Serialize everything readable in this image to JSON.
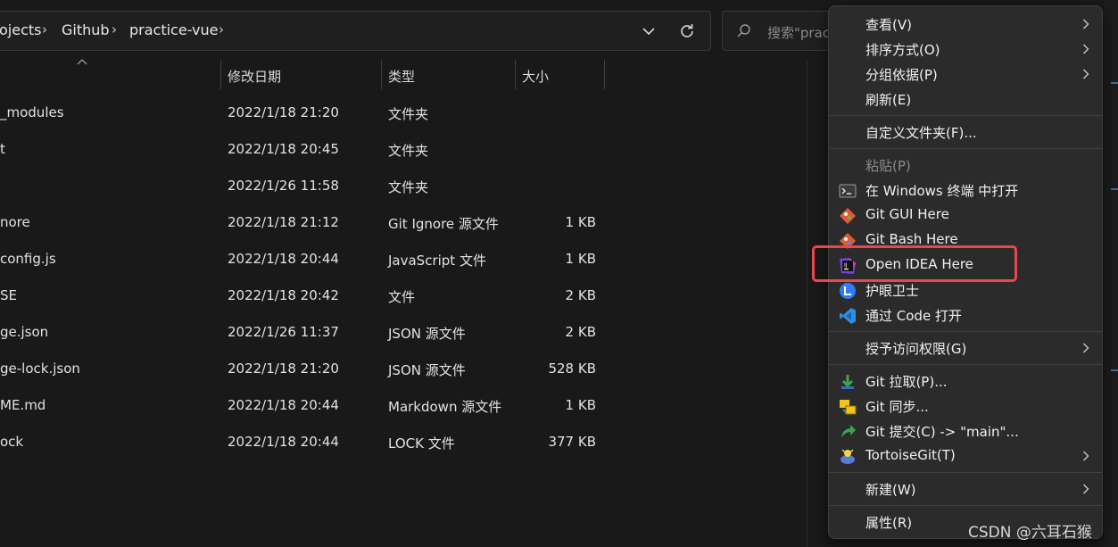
{
  "breadcrumb": {
    "items": [
      "ojects",
      "Github",
      "practice-vue"
    ],
    "separator": "›"
  },
  "search": {
    "placeholder": "搜索\"prac"
  },
  "columns": {
    "date": "修改日期",
    "type": "类型",
    "size": "大小"
  },
  "files": [
    {
      "name": "_modules",
      "date": "2022/1/18 21:20",
      "type": "文件夹",
      "size": ""
    },
    {
      "name": "t",
      "date": "2022/1/18 20:45",
      "type": "文件夹",
      "size": ""
    },
    {
      "name": "",
      "date": "2022/1/26 11:58",
      "type": "文件夹",
      "size": ""
    },
    {
      "name": "nore",
      "date": "2022/1/18 21:12",
      "type": "Git Ignore 源文件",
      "size": "1 KB"
    },
    {
      "name": "config.js",
      "date": "2022/1/18 20:44",
      "type": "JavaScript 文件",
      "size": "1 KB"
    },
    {
      "name": "SE",
      "date": "2022/1/18 20:42",
      "type": "文件",
      "size": "2 KB"
    },
    {
      "name": "ge.json",
      "date": "2022/1/26 11:37",
      "type": "JSON 源文件",
      "size": "2 KB"
    },
    {
      "name": "ge-lock.json",
      "date": "2022/1/18 21:20",
      "type": "JSON 源文件",
      "size": "528 KB"
    },
    {
      "name": "ME.md",
      "date": "2022/1/18 20:44",
      "type": "Markdown 源文件",
      "size": "1 KB"
    },
    {
      "name": "ock",
      "date": "2022/1/18 20:44",
      "type": "LOCK 文件",
      "size": "377 KB"
    }
  ],
  "menu": {
    "view": "查看(V)",
    "sort": "排序方式(O)",
    "group": "分组依据(P)",
    "refresh": "刷新(E)",
    "customize": "自定义文件夹(F)...",
    "paste": "粘贴(P)",
    "terminal": "在 Windows 终端 中打开",
    "git_gui": "Git GUI Here",
    "git_bash": "Git Bash Here",
    "open_idea": "Open IDEA Here",
    "eye_guard": "护眼卫士",
    "vscode": "通过 Code 打开",
    "access": "授予访问权限(G)",
    "git_pull": "Git 拉取(P)...",
    "git_sync": "Git 同步...",
    "git_commit": "Git 提交(C) -> \"main\"...",
    "tortoisegit": "TortoiseGit(T)",
    "new": "新建(W)",
    "properties": "属性(R)"
  },
  "watermark": "CSDN @六耳石猴",
  "colors": {
    "background": "#191919",
    "menu_bg": "#2b2b2b",
    "highlight": "#e8474f"
  }
}
